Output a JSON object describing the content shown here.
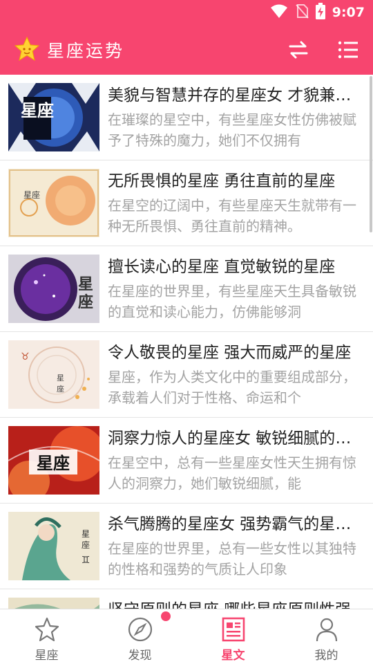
{
  "status": {
    "time": "9:07"
  },
  "app": {
    "title": "星座运势"
  },
  "colors": {
    "accent": "#f7456f",
    "desc_text": "#a3a3a3",
    "title_text": "#222222"
  },
  "articles": [
    {
      "title": "美貌与智慧并存的星座女 才貌兼备的星座女",
      "desc": "在璀璨的星空中，有些星座女性仿佛被赋予了特殊的魔力，她们不仅拥有",
      "thumb_text": "星座"
    },
    {
      "title": "无所畏惧的星座 勇往直前的星座",
      "desc": "在星空的辽阔中，有些星座天生就带有一种无所畏惧、勇往直前的精神。",
      "thumb_text": "星座"
    },
    {
      "title": "擅长读心的星座 直觉敏锐的星座",
      "desc": "在星座的世界里，有些星座天生具备敏锐的直觉和读心能力，仿佛能够洞",
      "thumb_text": "星座"
    },
    {
      "title": "令人敬畏的星座 强大而威严的星座",
      "desc": "星座，作为人类文化中的重要组成部分，承载着人们对于性格、命运和个",
      "thumb_text": "星座"
    },
    {
      "title": "洞察力惊人的星座女 敏锐细腻的星座女",
      "desc": "在星空中，总有一些星座女性天生拥有惊人的洞察力，她们敏锐细腻，能",
      "thumb_text": "星座"
    },
    {
      "title": "杀气腾腾的星座女 强势霸气的星座女",
      "desc": "在星座的世界里，总有一些女性以其独特的性格和强势的气质让人印象",
      "thumb_text": "星座"
    },
    {
      "title": "坚守原则的星座 哪些星座原则性强",
      "desc": "",
      "thumb_text": ""
    }
  ],
  "nav": [
    {
      "label": "星座",
      "icon": "star-icon"
    },
    {
      "label": "发现",
      "icon": "compass-icon"
    },
    {
      "label": "星文",
      "icon": "article-icon"
    },
    {
      "label": "我的",
      "icon": "person-icon"
    }
  ]
}
